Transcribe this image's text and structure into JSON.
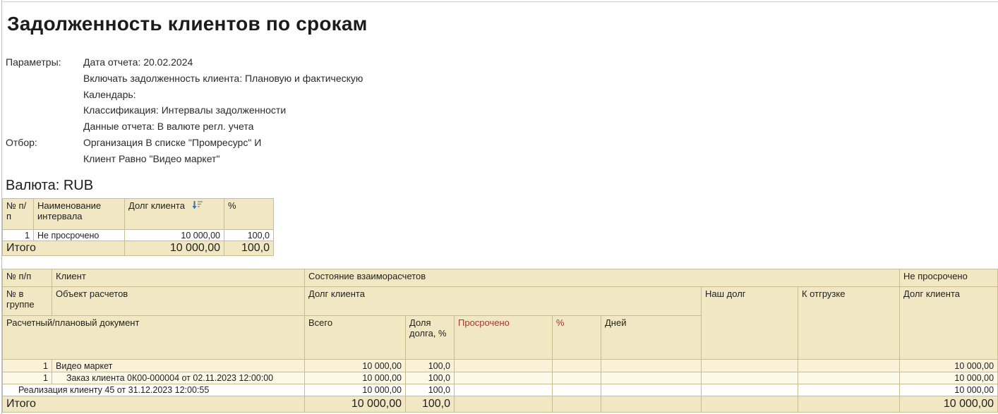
{
  "title": "Задолженность клиентов по срокам",
  "parameters": {
    "label": "Параметры:",
    "lines": [
      "Дата отчета: 20.02.2024",
      "Включать задолженность клиента: Плановую и фактическую",
      "Календарь:",
      "Классификация: Интервалы задолженности",
      "Данные отчета: В валюте регл. учета"
    ],
    "filter_label": "Отбор:",
    "filter_lines": [
      "Организация В списке \"Промресурс\" И",
      "Клиент Равно \"Видео маркет\""
    ]
  },
  "currency_heading": "Валюта: RUB",
  "intervals_table": {
    "headers": {
      "num": "№ п/п",
      "interval": "Наименование интервала",
      "debt": "Долг клиента",
      "percent": "%"
    },
    "sort_icon": "sort-descending",
    "rows": [
      {
        "num": "1",
        "interval": "Не просрочено",
        "debt": "10 000,00",
        "percent": "100,0"
      }
    ],
    "total": {
      "label": "Итого",
      "debt": "10 000,00",
      "percent": "100,0"
    }
  },
  "details_table": {
    "headers": {
      "num": "№ п/п",
      "client": "Клиент",
      "state": "Состояние взаиморасчетов",
      "not_overdue_group": "Не просрочено",
      "num_group": "№ в группе",
      "object": "Объект расчетов",
      "client_debt": "Долг клиента",
      "our_debt": "Наш долг",
      "to_ship": "К отгрузке",
      "client_debt_not_overdue": "Долг клиента",
      "document": "Расчетный/плановый документ",
      "total": "Всего",
      "debt_share": "Доля долга, %",
      "overdue": "Просрочено",
      "overdue_percent": "%",
      "days": "Дней"
    },
    "rows": [
      {
        "num": "1",
        "name": "Видео маркет",
        "total": "10 000,00",
        "share": "100,0",
        "overdue": "",
        "percent": "",
        "days": "",
        "our_debt": "",
        "to_ship": "",
        "not_overdue": "10 000,00"
      },
      {
        "num": "1",
        "name": "Заказ клиента 0К00-000004 от 02.11.2023 12:00:00",
        "total": "10 000,00",
        "share": "100,0",
        "overdue": "",
        "percent": "",
        "days": "",
        "our_debt": "",
        "to_ship": "",
        "not_overdue": "10 000,00"
      },
      {
        "num": "",
        "name": "Реализация клиенту 45 от 31.12.2023 12:00:55",
        "total": "10 000,00",
        "share": "100,0",
        "overdue": "",
        "percent": "",
        "days": "",
        "our_debt": "",
        "to_ship": "",
        "not_overdue": "10 000,00"
      }
    ],
    "total": {
      "label": "Итого",
      "total": "10 000,00",
      "share": "100,0",
      "not_overdue": "10 000,00"
    }
  },
  "colors": {
    "header_bg": "#f1e7c2",
    "grid_border": "#c8bc92",
    "row_level1_bg": "#f9f2d8",
    "row_level2_bg": "#fdf9e8",
    "row_level3_bg": "#ffffff",
    "overdue_red": "#b03030",
    "sort_arrow_blue": "#3a6fbf"
  }
}
